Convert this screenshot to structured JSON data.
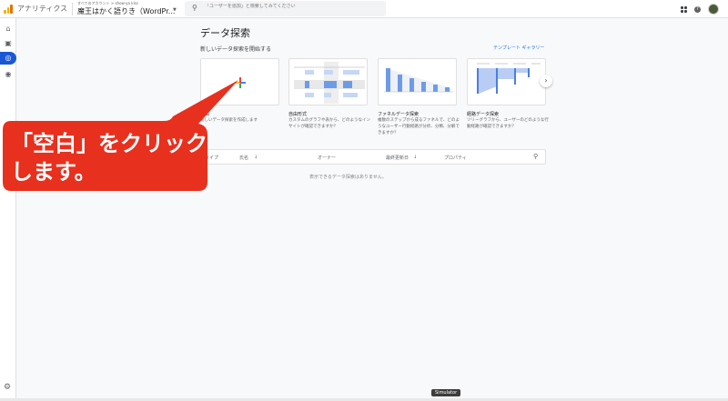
{
  "header": {
    "app_name": "アナリティクス",
    "account_path": "すべてのアカウント > show-ya kiss",
    "property": "魔王はかく語りき（WordPr...",
    "search_placeholder": "「ユーザーを追加」と検索してみてください"
  },
  "sidebar": {
    "items": [
      {
        "icon": "home-icon"
      },
      {
        "icon": "reports-icon"
      },
      {
        "icon": "explore-icon",
        "active": true
      },
      {
        "icon": "advertising-icon"
      }
    ]
  },
  "main": {
    "title": "データ探索",
    "subtitle": "新しいデータ探索を開始する",
    "gallery_link": "テンプレート ギャラリー",
    "templates": [
      {
        "title": "空白",
        "desc": "新しいデータ探索を作成します"
      },
      {
        "title": "自由形式",
        "desc": "カスタムのグラフや表から、どのようなインサイトが確認できますか？"
      },
      {
        "title": "ファネルデータ探索",
        "desc": "複数のステップから成るファネルで、どのようなユーザー行動経路が分析、分類、分解できますか？"
      },
      {
        "title": "経路データ探索",
        "desc": "ツリーグラフから、ユーザーのどのような行動経路が確認できますか？"
      }
    ],
    "table_headers": [
      "タイプ",
      "氏名",
      "オーナー",
      "最終更新日",
      "プロパティ"
    ],
    "empty_message": "表示できるデータ探索はありません。"
  },
  "callout": {
    "line1": "「空白」をクリック",
    "line2": "します。",
    "color": "#e8301e"
  },
  "tooltip": "Simulator",
  "colors": {
    "accent": "#1a73e8",
    "active_nav": "#1a57d3"
  }
}
